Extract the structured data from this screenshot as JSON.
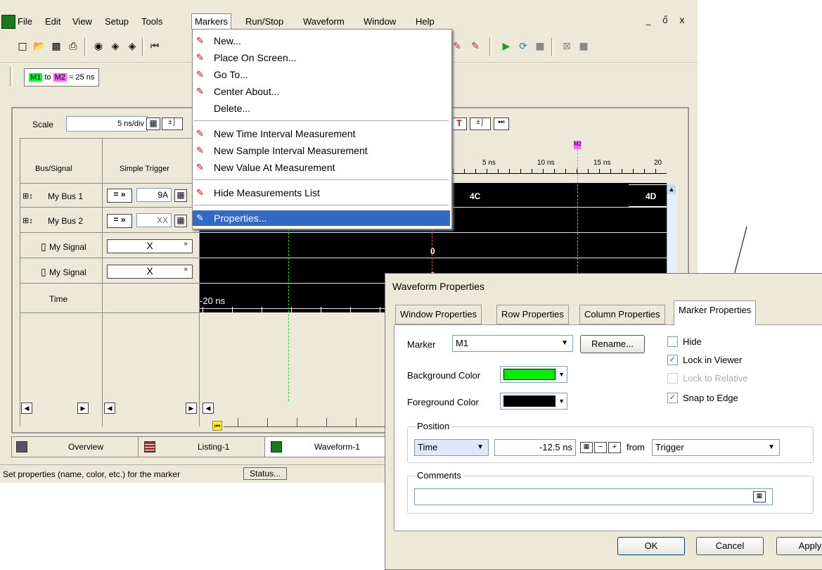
{
  "menubar": {
    "items": [
      "File",
      "Edit",
      "View",
      "Setup",
      "Tools",
      "Markers",
      "Run/Stop",
      "Waveform",
      "Window",
      "Help"
    ]
  },
  "window_controls": {
    "minimize": "_",
    "restore": "ő",
    "close": "x"
  },
  "markerbar": {
    "m1": "M1",
    "to": "to",
    "m2": "M2",
    "eq": "= 25 ns"
  },
  "markers_menu": {
    "items": [
      {
        "label": "New...",
        "icon": "new-marker-icon"
      },
      {
        "label": "Place On Screen...",
        "icon": "place-marker-icon"
      },
      {
        "label": "Go To...",
        "icon": "goto-marker-icon"
      },
      {
        "label": "Center About...",
        "icon": "center-marker-icon"
      },
      {
        "label": "Delete...",
        "icon": ""
      },
      {
        "label": "New Time Interval Measurement",
        "icon": "time-interval-icon"
      },
      {
        "label": "New Sample Interval Measurement",
        "icon": "sample-interval-icon"
      },
      {
        "label": "New Value At Measurement",
        "icon": "value-at-icon"
      },
      {
        "label": "Hide Measurements List",
        "icon": "hide-list-icon"
      },
      {
        "label": "Properties...",
        "icon": "properties-icon"
      }
    ]
  },
  "waveform": {
    "scale_label": "Scale",
    "scale_value": "5 ns/div",
    "col_bus": "Bus/Signal",
    "col_trigger": "Simple Trigger",
    "rows": [
      {
        "name": "My Bus 1",
        "op": "=",
        "val": "9A"
      },
      {
        "name": "My Bus 2",
        "op": "=",
        "val": "XX"
      },
      {
        "name": "My Signal",
        "trig": "X"
      },
      {
        "name": "My Signal",
        "trig": "X"
      },
      {
        "name": "Time"
      }
    ],
    "ticks": [
      "5 ns",
      "10 ns",
      "15 ns",
      "20"
    ],
    "m2_label": "M2",
    "bus1_a": "4C",
    "bus1_b": "4D",
    "sig_val1": "0",
    "sig_val2": "0",
    "time_label": "-20 ns"
  },
  "tabs": [
    {
      "label": "Overview"
    },
    {
      "label": "Listing-1"
    },
    {
      "label": "Waveform-1"
    }
  ],
  "status": {
    "text": "Set properties (name, color, etc.) for the marker",
    "button": "Status..."
  },
  "dialog": {
    "title": "Waveform Properties",
    "tabs": [
      "Window Properties",
      "Row Properties",
      "Column Properties",
      "Marker Properties"
    ],
    "marker_label": "Marker",
    "marker_value": "M1",
    "rename": "Rename...",
    "bg_color_label": "Background Color",
    "fg_color_label": "Foreground Color",
    "bg_color": "#00ee00",
    "fg_color": "#000000",
    "hide": "Hide",
    "lock_viewer": "Lock in Viewer",
    "lock_relative": "Lock to Relative",
    "snap_edge": "Snap to Edge",
    "position_group": "Position",
    "position_mode": "Time",
    "position_value": "-12.5 ns",
    "from": "from",
    "reference": "Trigger",
    "comments_group": "Comments",
    "comments_value": "",
    "ok": "OK",
    "cancel": "Cancel",
    "apply": "Apply"
  }
}
